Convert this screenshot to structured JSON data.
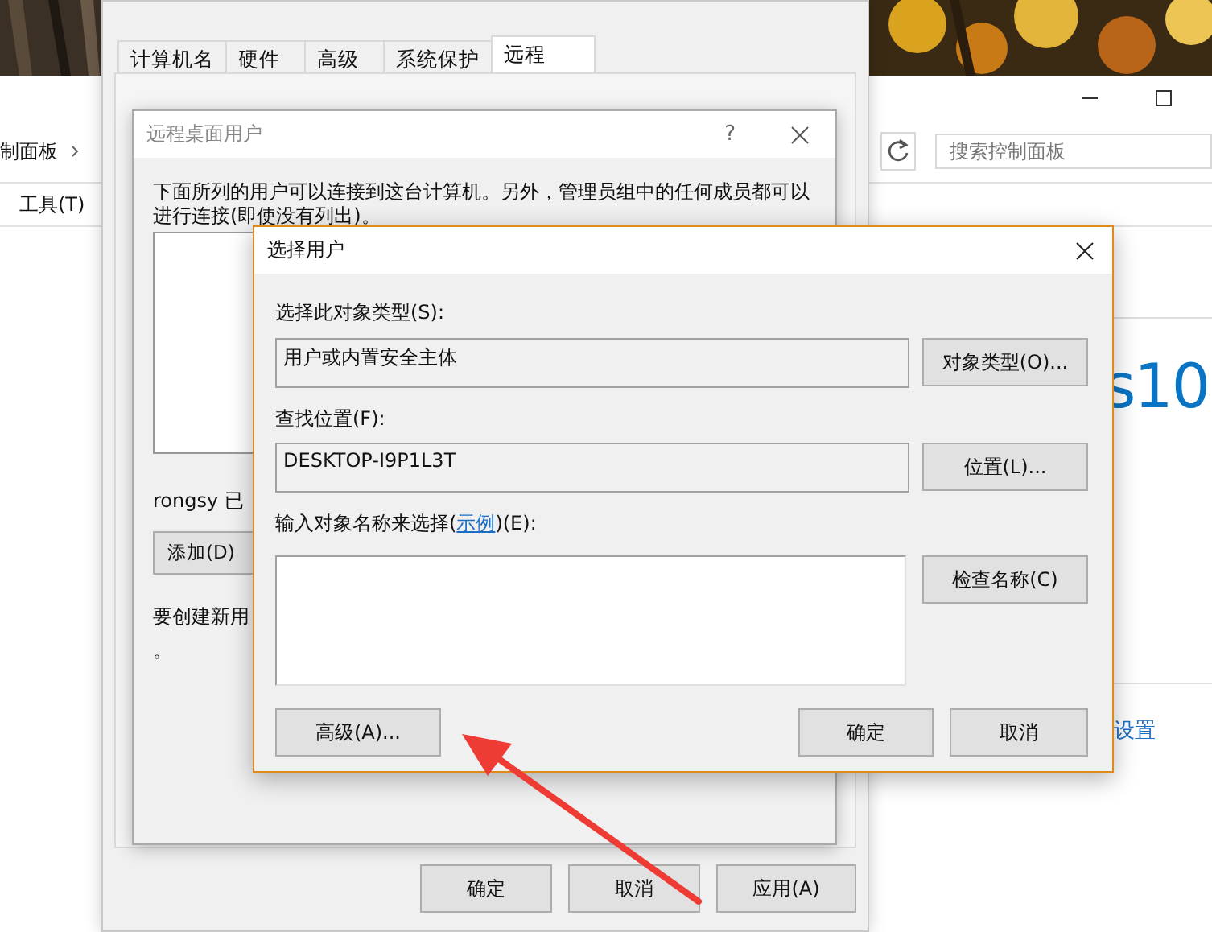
{
  "control_panel": {
    "breadcrumb": [
      "制面板"
    ],
    "search": {
      "placeholder": "搜索控制面板"
    },
    "menu": [
      "工具(T)"
    ],
    "heading_fragment": "s10",
    "link": "设置"
  },
  "system_properties": {
    "tabs": [
      {
        "label": "计算机名",
        "selected": false
      },
      {
        "label": "硬件",
        "selected": false
      },
      {
        "label": "高级",
        "selected": false
      },
      {
        "label": "系统保护",
        "selected": false
      },
      {
        "label": "远程",
        "selected": true
      }
    ],
    "buttons": [
      "确定",
      "取消",
      "应用(A)"
    ]
  },
  "remote_desktop_users": {
    "title": "远程桌面用户",
    "help": "?",
    "description": "下面所列的用户可以连接到这台计算机。另外，管理员组中的任何成员都可以进行连接(即使没有列出)。",
    "user_status": "rongsy 已",
    "add_button": "添加(D)",
    "create_hint": "要创建新用",
    "create_hint_end": "。"
  },
  "select_users": {
    "title": "选择用户",
    "object_type": {
      "label": "选择此对象类型(S):",
      "value": "用户或内置安全主体",
      "button": "对象类型(O)..."
    },
    "location": {
      "label": "查找位置(F):",
      "value": "DESKTOP-I9P1L3T",
      "button": "位置(L)..."
    },
    "names": {
      "label_before": "输入对象名称来选择(",
      "link": "示例",
      "label_after": ")(E):",
      "button": "检查名称(C)"
    },
    "buttons": [
      "高级(A)...",
      "确定",
      "取消"
    ]
  }
}
